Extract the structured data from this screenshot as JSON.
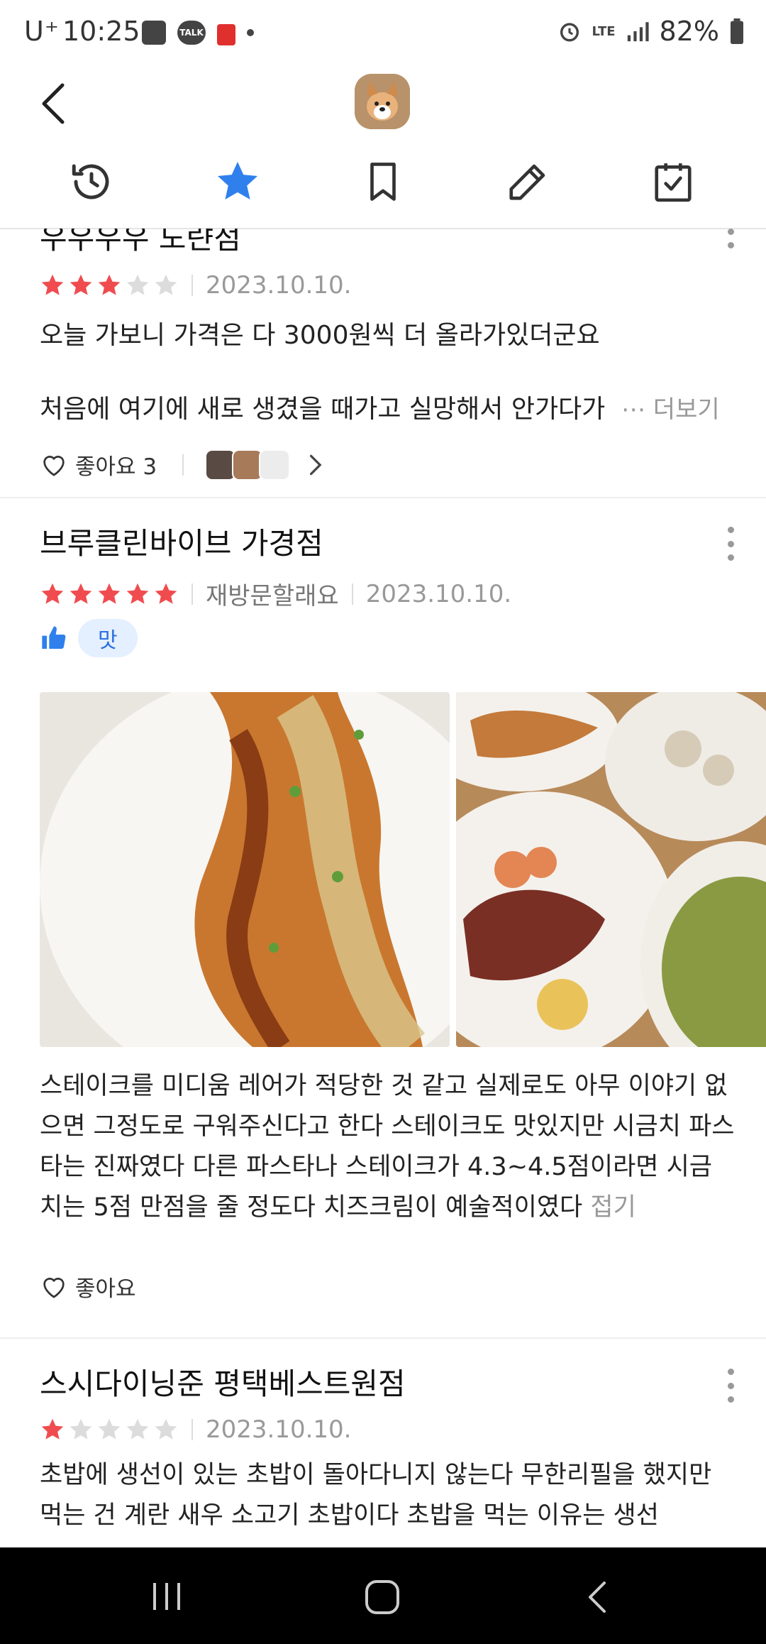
{
  "status_bar": {
    "carrier": "U⁺",
    "time": "10:25",
    "battery": "82%",
    "network": "LTE"
  },
  "header": {
    "tabs": [
      {
        "name": "history"
      },
      {
        "name": "favorites",
        "active": true
      },
      {
        "name": "saved"
      },
      {
        "name": "write-review"
      },
      {
        "name": "visited"
      }
    ]
  },
  "colors": {
    "accent": "#2f80ed",
    "star_on": "#f04c50",
    "star_off": "#dcdcdc"
  },
  "reviews": [
    {
      "title": "우우우우 도랸점",
      "rating": 3,
      "date": "2023.10.10.",
      "text_line1": "오늘 가보니 가격은 다 3000원씩 더 올라가있더군요",
      "text_line2": "처음에 여기에 새로 생겼을 때가고 실망해서 안가다가",
      "more_label": "⋯ 더보기",
      "like_label": "좋아요 3"
    },
    {
      "title": "브루클린바이브 가경점",
      "rating": 5,
      "revisit": "재방문할래요",
      "date": "2023.10.10.",
      "tag": "맛",
      "text": "스테이크를 미디움 레어가 적당한 것 같고 실제로도 아무 이야기 없으면 그정도로 구워주신다고 한다 스테이크도 맛있지만 시금치 파스타는 진짜였다 다른 파스타나 스테이크가 4.3~4.5점이라면 시금치는 5점 만점을 줄 정도다 치즈크림이 예술적이였다",
      "fold_label": "접기",
      "like_label": "좋아요"
    },
    {
      "title": "스시다이닝준 평택베스트원점",
      "rating": 1,
      "date": "2023.10.10.",
      "text": "초밥에 생선이 있는 초밥이 돌아다니지 않는다 무한리필을 했지만 먹는 건 계란 새우 소고기 초밥이다 초밥을 먹는 이유는 생선"
    }
  ]
}
